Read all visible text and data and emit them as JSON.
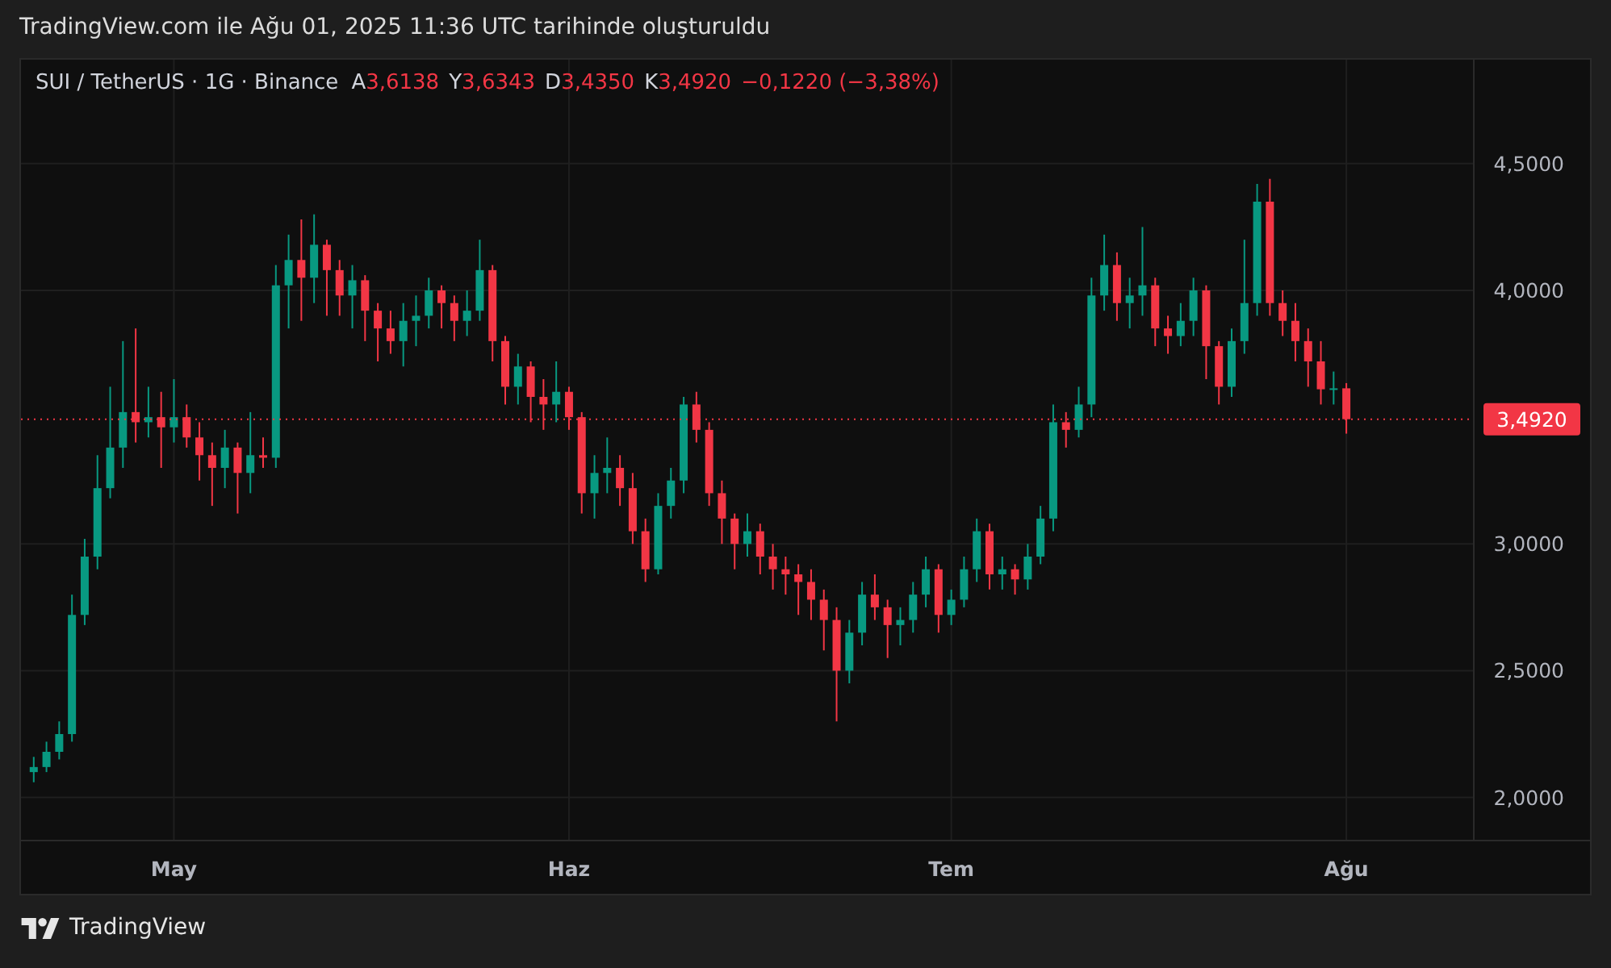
{
  "header": {
    "title": "TradingView.com ile Ağu 01, 2025 11:36 UTC tarihinde oluşturuldu"
  },
  "legend": {
    "symbol": "SUI / TetherUS · 1G · Binance",
    "fields": [
      {
        "label": "A",
        "value": "3,6138"
      },
      {
        "label": "Y",
        "value": "3,6343"
      },
      {
        "label": "D",
        "value": "3,4350"
      },
      {
        "label": "K",
        "value": "3,4920"
      }
    ],
    "change": "−0,1220 (−3,38%)"
  },
  "chart": {
    "last_price_label": "3,4920",
    "price_labels": [
      "4,5000",
      "4,0000",
      "3,0000",
      "2,5000",
      "2,0000"
    ],
    "time_labels": [
      "May",
      "Haz",
      "Tem",
      "Ağu"
    ]
  },
  "footer": {
    "brand": "TradingView"
  }
}
